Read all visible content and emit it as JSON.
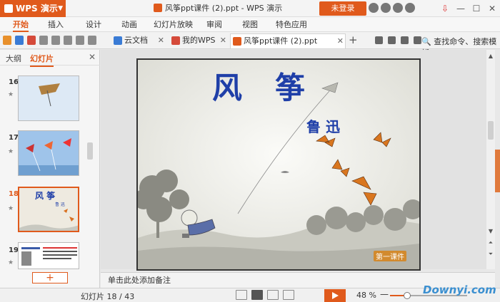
{
  "app": {
    "name": "WPS 演示",
    "window_title": "风筝ppt课件 (2).ppt - WPS 演示",
    "login_label": "未登录"
  },
  "menu": [
    "开始",
    "插入",
    "设计",
    "动画",
    "幻灯片放映",
    "审阅",
    "视图",
    "特色应用"
  ],
  "tabs": [
    {
      "label": "云文档",
      "color": "#3a7bd5"
    },
    {
      "label": "我的WPS",
      "color": "#d54a3a"
    },
    {
      "label": "风筝ppt课件 (2).ppt",
      "color": "#e05a1c"
    }
  ],
  "search_command": "查找命令、搜索模板",
  "left_panel": {
    "tabs": [
      "大纲",
      "幻灯片"
    ],
    "slides": [
      {
        "num": "16"
      },
      {
        "num": "17"
      },
      {
        "num": "18",
        "title": "风 筝",
        "subtitle": "鲁 迅"
      },
      {
        "num": "19"
      }
    ]
  },
  "slide": {
    "title": "风　筝",
    "author": "鲁 迅",
    "tag": "第一课件"
  },
  "notes_placeholder": "单击此处添加备注",
  "status": {
    "slide_counter": "幻灯片 18 / 43",
    "zoom": "48 %",
    "zoom_fraction": 0.22
  },
  "watermark": "Downyi.com",
  "colors": {
    "accent": "#e05a1c",
    "title_blue": "#1f3fa8"
  }
}
